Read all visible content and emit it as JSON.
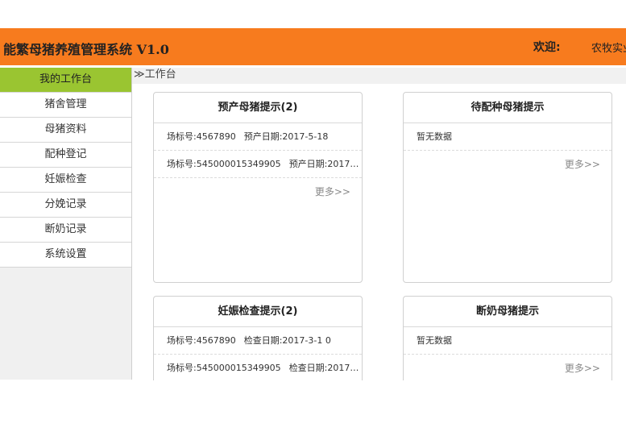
{
  "header": {
    "title": "能繁母猪养殖管理系统 V1.0",
    "welcome": "欢迎:",
    "user": "农牧实业",
    "bg_color": "#f77b1e"
  },
  "sidebar": {
    "items": [
      {
        "label": "我的工作台",
        "active": true
      },
      {
        "label": "猪舍管理"
      },
      {
        "label": "母猪资料"
      },
      {
        "label": "配种登记"
      },
      {
        "label": "妊娠检查"
      },
      {
        "label": "分娩记录"
      },
      {
        "label": "断奶记录"
      },
      {
        "label": "系统设置"
      }
    ],
    "active_color": "#9ac531"
  },
  "breadcrumb": "≫工作台",
  "panels": {
    "farrowing": {
      "title": "预产母猪提示(2)",
      "rows": [
        {
          "tag": "场标号:4567890",
          "date": "预产日期:2017-5-18"
        },
        {
          "tag": "场标号:545000015349905",
          "date": "预产日期:2017…"
        }
      ],
      "more": "更多>>"
    },
    "breeding": {
      "title": "待配种母猪提示",
      "empty": "暂无数据",
      "more": "更多>>"
    },
    "pregnancy": {
      "title": "妊娠检查提示(2)",
      "rows": [
        {
          "tag": "场标号:4567890",
          "date": "检查日期:2017-3-1 0"
        },
        {
          "tag": "场标号:545000015349905",
          "date": "检查日期:2017…"
        }
      ]
    },
    "weaning": {
      "title": "断奶母猪提示",
      "empty": "暂无数据",
      "more": "更多>>"
    }
  }
}
